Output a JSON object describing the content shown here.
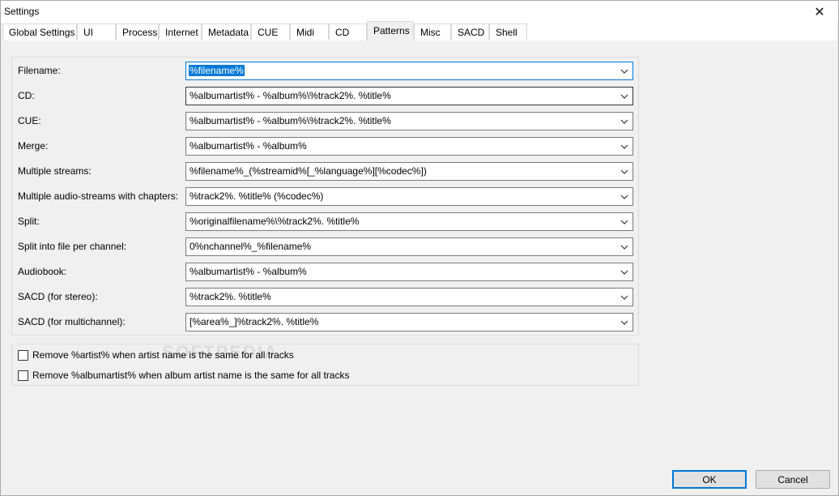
{
  "window": {
    "title": "Settings",
    "close_glyph": "✕"
  },
  "tabs": [
    {
      "label": "Global Settings"
    },
    {
      "label": "UI"
    },
    {
      "label": "Process"
    },
    {
      "label": "Internet"
    },
    {
      "label": "Metadata"
    },
    {
      "label": "CUE"
    },
    {
      "label": "Midi"
    },
    {
      "label": "CD"
    },
    {
      "label": "Patterns"
    },
    {
      "label": "Misc"
    },
    {
      "label": "SACD"
    },
    {
      "label": "Shell"
    }
  ],
  "active_tab": "Patterns",
  "patterns": [
    {
      "label": "Filename:",
      "value": "%filename%"
    },
    {
      "label": "CD:",
      "value": "%albumartist% - %album%\\%track2%. %title%"
    },
    {
      "label": "CUE:",
      "value": "%albumartist% - %album%\\%track2%. %title%"
    },
    {
      "label": "Merge:",
      "value": "%albumartist% - %album%"
    },
    {
      "label": "Multiple streams:",
      "value": "%filename%_(%streamid%[_%language%][%codec%])"
    },
    {
      "label": "Multiple audio-streams with chapters:",
      "value": "%track2%. %title% (%codec%)"
    },
    {
      "label": "Split:",
      "value": "%originalfilename%\\%track2%. %title%"
    },
    {
      "label": "Split into file per channel:",
      "value": "0%nchannel%_%filename%"
    },
    {
      "label": "Audiobook:",
      "value": "%albumartist% - %album%"
    },
    {
      "label": "SACD (for stereo):",
      "value": "%track2%. %title%"
    },
    {
      "label": "SACD (for multichannel):",
      "value": "[%area%_]%track2%. %title%"
    }
  ],
  "options": [
    {
      "label": "Remove %artist% when artist name is the same for all tracks",
      "checked": false
    },
    {
      "label": "Remove %albumartist% when album artist name is the same for all tracks",
      "checked": false
    }
  ],
  "buttons": {
    "ok": "OK",
    "cancel": "Cancel"
  },
  "watermark": "SOFTPEDIA",
  "colors": {
    "accent": "#0078d7",
    "window_bg": "#f0f0f0"
  }
}
